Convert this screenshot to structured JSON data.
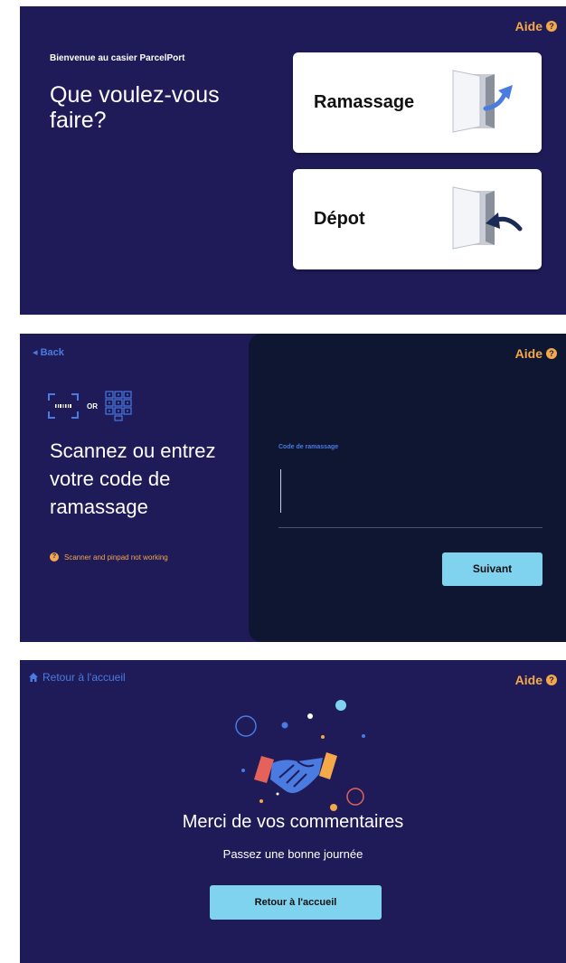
{
  "panel_choose": {
    "help": "Aide",
    "welcome": "Bienvenue au casier ParcelPort",
    "question": "Que voulez-vous faire?",
    "options": [
      {
        "label": "Ramassage",
        "icon": "door-arrow-out-icon"
      },
      {
        "label": "Dépot",
        "icon": "door-arrow-in-icon"
      }
    ]
  },
  "panel_scan": {
    "back": "Back",
    "help": "Aide",
    "or": "OR",
    "title": "Scannez ou entrez votre code de ramassage",
    "scanner_help": "Scanner and pinpad not working",
    "code_label": "Code de ramassage",
    "code_value": "",
    "next": "Suivant",
    "icons": [
      "barcode-scan-icon",
      "keypad-icon"
    ]
  },
  "panel_thanks": {
    "home_link": "Retour à l'accueil",
    "help": "Aide",
    "title": "Merci de vos commentaires",
    "subtitle": "Passez une bonne journée",
    "home_button": "Retour à l'accueil",
    "illustration": "handshake-illustration"
  },
  "colors": {
    "background": "#1f1b58",
    "dark_panel": "#0f1631",
    "accent_orange": "#f4a84a",
    "accent_blue": "#4a7be0",
    "button_cyan": "#7fd3ef"
  }
}
